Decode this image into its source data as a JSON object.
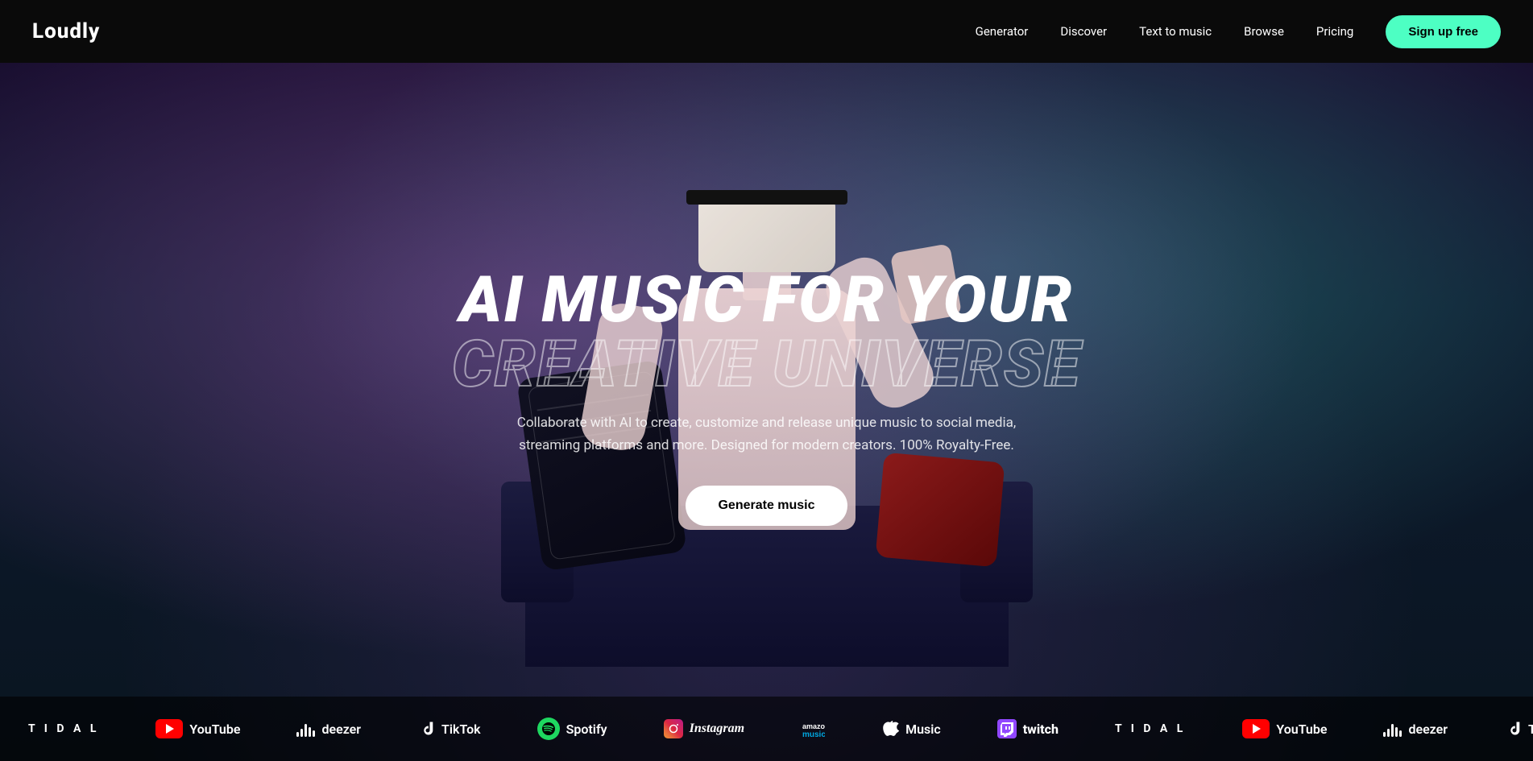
{
  "navbar": {
    "logo": "Loudly",
    "links": [
      {
        "id": "generator",
        "label": "Generator"
      },
      {
        "id": "discover",
        "label": "Discover"
      },
      {
        "id": "text-to-music",
        "label": "Text to music"
      },
      {
        "id": "browse",
        "label": "Browse"
      },
      {
        "id": "pricing",
        "label": "Pricing"
      }
    ],
    "signup_label": "Sign up free"
  },
  "hero": {
    "title_line1": "AI MUSIC FOR YOUR",
    "title_line2": "CREATIVE UNIVERSE",
    "subtitle": "Collaborate with AI to create, customize and release unique music to social media, streaming platforms and more. Designed for modern creators. 100% Royalty-Free.",
    "cta_label": "Generate music"
  },
  "logos": [
    {
      "id": "tidal1",
      "type": "tidal",
      "text": "T I D A L"
    },
    {
      "id": "youtube1",
      "type": "youtube",
      "text": "YouTube"
    },
    {
      "id": "deezer1",
      "type": "deezer",
      "text": "deezer"
    },
    {
      "id": "tiktok1",
      "type": "tiktok",
      "text": "TikTok"
    },
    {
      "id": "spotify1",
      "type": "spotify",
      "text": "Spotify"
    },
    {
      "id": "instagram1",
      "type": "instagram",
      "text": "Instagram"
    },
    {
      "id": "amazon1",
      "type": "amazon",
      "text": "music"
    },
    {
      "id": "apple1",
      "type": "apple",
      "text": "Music"
    },
    {
      "id": "twitch1",
      "type": "twitch",
      "text": "twitch"
    },
    {
      "id": "tidal2",
      "type": "tidal",
      "text": "T I D A L"
    },
    {
      "id": "youtube2",
      "type": "youtube",
      "text": "YouTube"
    },
    {
      "id": "deezer2",
      "type": "deezer",
      "text": "deezer"
    },
    {
      "id": "tiktok2",
      "type": "tiktok",
      "text": "TikTok"
    }
  ],
  "colors": {
    "accent": "#4dffc3",
    "navbar_bg": "#0a0a0a",
    "hero_bg_start": "#1a0a2e",
    "hero_bg_end": "#0a1520"
  }
}
